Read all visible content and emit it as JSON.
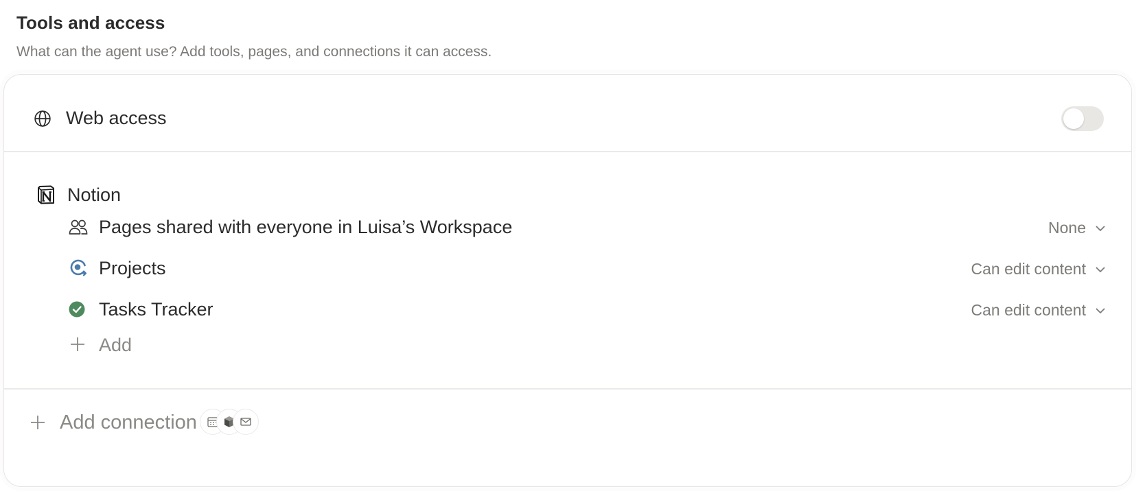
{
  "section": {
    "title": "Tools and access",
    "description": "What can the agent use? Add tools, pages, and connections it can access."
  },
  "web_access": {
    "label": "Web access",
    "icon": "globe-icon",
    "enabled": false
  },
  "notion": {
    "label": "Notion",
    "icon": "notion-logo-icon",
    "items": [
      {
        "label": "Pages shared with everyone in Luisa’s Workspace",
        "icon": "people-icon",
        "permission": "None"
      },
      {
        "label": "Projects",
        "icon": "projects-icon",
        "permission": "Can edit content",
        "icon_color": "#4a7bab"
      },
      {
        "label": "Tasks Tracker",
        "icon": "check-circle-icon",
        "permission": "Can edit content",
        "icon_color": "#4e8a5e"
      }
    ],
    "add_label": "Add"
  },
  "connections": {
    "add_label": "Add connection",
    "icons": [
      "calendar-icon",
      "cube-icon",
      "mail-icon"
    ]
  }
}
